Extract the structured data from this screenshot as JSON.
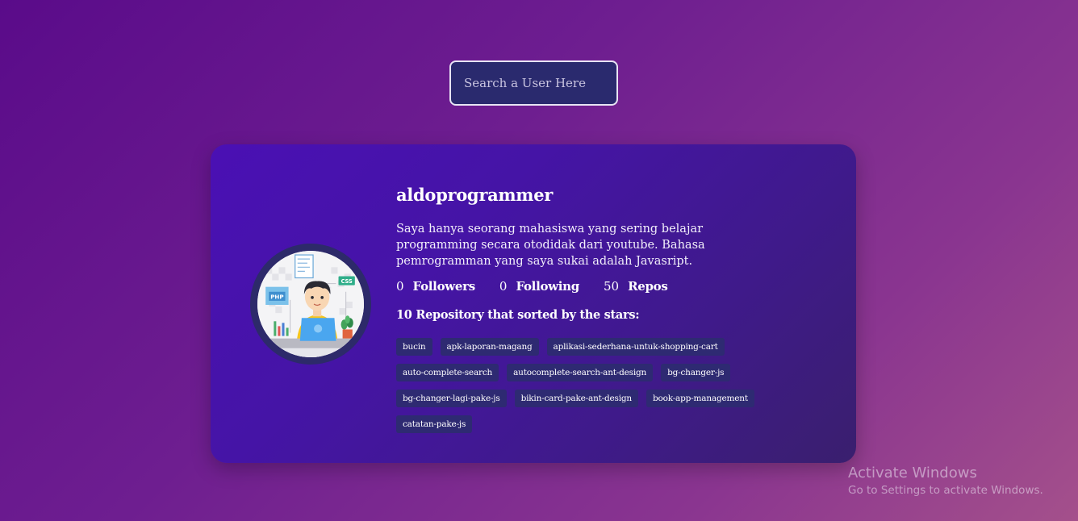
{
  "search": {
    "placeholder": "Search a User Here"
  },
  "profile": {
    "username": "aldoprogrammer",
    "bio": "Saya hanya seorang mahasiswa yang sering belajar programming secara otodidak dari youtube. Bahasa pemrogramman yang saya sukai adalah Javasript.",
    "stats": [
      {
        "value": "0",
        "label": "Followers"
      },
      {
        "value": "0",
        "label": "Following"
      },
      {
        "value": "50",
        "label": "Repos"
      }
    ],
    "avatar": {
      "icon": "programmer-avatar-icon",
      "labels": [
        "PHP",
        "CSS"
      ]
    }
  },
  "repositories": {
    "title": "10 Repository that sorted by the stars:",
    "items": [
      "bucin",
      "apk-laporan-magang",
      "aplikasi-sederhana-untuk-shopping-cart",
      "auto-complete-search",
      "autocomplete-search-ant-design",
      "bg-changer-js",
      "bg-changer-lagi-pake-js",
      "bikin-card-pake-ant-design",
      "book-app-management",
      "catatan-pake-js"
    ]
  },
  "watermark": {
    "title": "Activate Windows",
    "subtitle": "Go to Settings to activate Windows."
  }
}
